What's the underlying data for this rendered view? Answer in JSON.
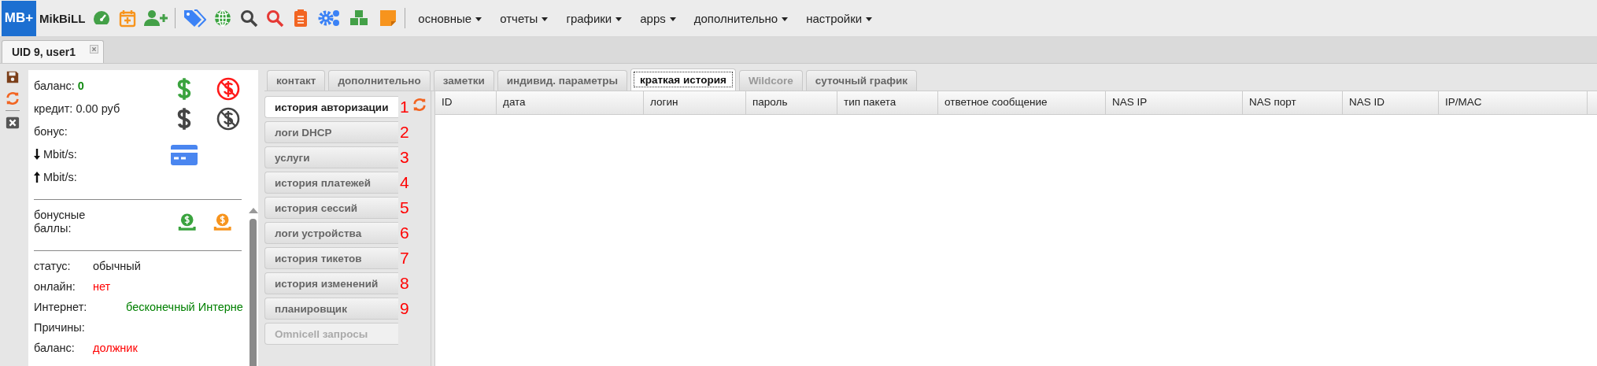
{
  "toolbar": {
    "logo_badge": "MB+",
    "logo_name": "MikBiLL",
    "menus": [
      "основные",
      "отчеты",
      "графики",
      "apps",
      "дополнительно",
      "настройки"
    ]
  },
  "doc_tabs": [
    {
      "label": "UID 9, user1",
      "selected": true
    }
  ],
  "info": {
    "balance_label": "баланс:",
    "balance_value": "0",
    "credit_label": "кредит:",
    "credit_value": "0.00 руб",
    "bonus_label": "бонус:",
    "down_label": "Mbit/s:",
    "up_label": "Mbit/s:",
    "bonus_points_label": "бонусные баллы:",
    "rows": [
      {
        "label": "статус:",
        "value": "обычный"
      },
      {
        "label": "онлайн:",
        "value": "нет",
        "color": "#ff0000"
      },
      {
        "label": "Интернет:",
        "value": "бесконечный Интерне",
        "color": "#008000"
      },
      {
        "label": "Причины:"
      },
      {
        "label": "баланс:",
        "value": "должник",
        "color": "#ff0000"
      }
    ]
  },
  "tabs": [
    {
      "label": "контакт",
      "selected": false,
      "disabled": false
    },
    {
      "label": "дополнительно",
      "selected": false,
      "disabled": false
    },
    {
      "label": "заметки",
      "selected": false,
      "disabled": false
    },
    {
      "label": "индивид. параметры",
      "selected": false,
      "disabled": false
    },
    {
      "label": "краткая история",
      "selected": true,
      "disabled": false
    },
    {
      "label": "Wildcore",
      "selected": false,
      "disabled": true
    },
    {
      "label": "суточный график",
      "selected": false,
      "disabled": false
    }
  ],
  "subtabs": [
    {
      "label": "история авторизации",
      "number": "1",
      "selected": true,
      "disabled": false
    },
    {
      "label": "логи DHCP",
      "number": "2",
      "selected": false,
      "disabled": false
    },
    {
      "label": "услуги",
      "number": "3",
      "selected": false,
      "disabled": false
    },
    {
      "label": "история платежей",
      "number": "4",
      "selected": false,
      "disabled": false
    },
    {
      "label": "история сессий",
      "number": "5",
      "selected": false,
      "disabled": false
    },
    {
      "label": "логи устройства",
      "number": "6",
      "selected": false,
      "disabled": false
    },
    {
      "label": "история тикетов",
      "number": "7",
      "selected": false,
      "disabled": false
    },
    {
      "label": "история изменений",
      "number": "8",
      "selected": false,
      "disabled": false
    },
    {
      "label": "планировщик",
      "number": "9",
      "selected": false,
      "disabled": false
    },
    {
      "label": "Omnicell запросы",
      "selected": false,
      "disabled": true
    }
  ],
  "table": {
    "columns": [
      "ID",
      "дата",
      "логин",
      "пароль",
      "тип пакета",
      "ответное сообщение",
      "NAS IP",
      "NAS порт",
      "NAS ID",
      "IP/MAC"
    ]
  }
}
